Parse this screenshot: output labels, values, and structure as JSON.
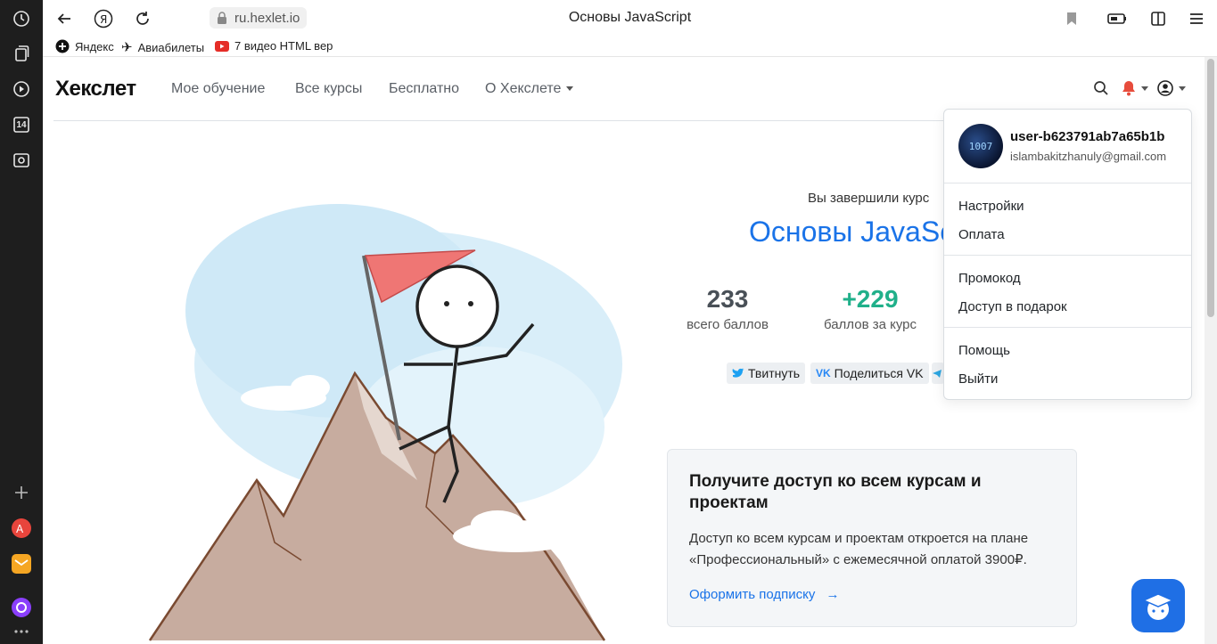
{
  "browser": {
    "address": "ru.hexlet.io",
    "tab_title": "Основы JavaScript"
  },
  "bookmarks": [
    {
      "label": "Яндекс",
      "icon": "yandex-icon"
    },
    {
      "label": "Авиабилеты",
      "icon": "plane-icon"
    },
    {
      "label": "7 видео HTML вер",
      "icon": "youtube-icon"
    }
  ],
  "sidebar": {
    "counter_badge": "14"
  },
  "site": {
    "logo": "Хекслет",
    "nav": [
      "Мое обучение",
      "Все курсы",
      "Бесплатно",
      "О Хекслете"
    ]
  },
  "result": {
    "finished_label": "Вы завершили курс",
    "course_title": "Основы JavaSc",
    "stats": [
      {
        "value": "233",
        "label": "всего баллов",
        "color": "#495057"
      },
      {
        "value": "+229",
        "label": "баллов за курс",
        "color": "#20b08a"
      }
    ],
    "share": {
      "twitter": "Твитнуть",
      "vk": "Поделиться VK"
    }
  },
  "promo": {
    "title": "Получите доступ ко всем курсам и проектам",
    "text": "Доступ ко всем курсам и проектам откроется на плане «Профессиональный» с ежемесячной оплатой 3900₽.",
    "link": "Оформить подписку"
  },
  "user_menu": {
    "avatar_text": "1007",
    "username": "user-b623791ab7a65b1b",
    "email": "islambakitzhanuly@gmail.com",
    "items": [
      "Настройки",
      "Оплата",
      "Промокод",
      "Доступ в подарок",
      "Помощь",
      "Выйти"
    ]
  },
  "colors": {
    "accent": "#1a73e8",
    "success": "#20b08a",
    "notification": "#e74c3c"
  }
}
